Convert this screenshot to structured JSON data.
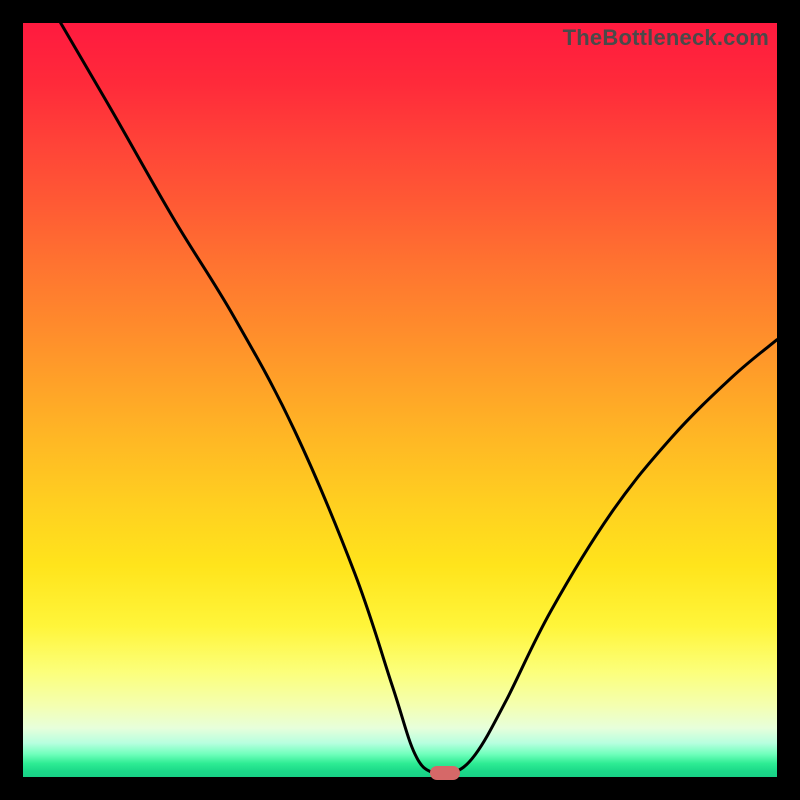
{
  "watermark": "TheBottleneck.com",
  "chart_data": {
    "type": "line",
    "title": "",
    "xlabel": "",
    "ylabel": "",
    "xlim": [
      0,
      100
    ],
    "ylim": [
      0,
      100
    ],
    "grid": false,
    "legend": false,
    "series": [
      {
        "name": "bottleneck-curve",
        "x": [
          5,
          12,
          20,
          28,
          36,
          44,
          49,
          52,
          54.5,
          57,
          60,
          64,
          70,
          78,
          86,
          94,
          100
        ],
        "y": [
          100,
          88,
          74,
          61,
          46,
          27,
          12,
          3,
          0.5,
          0.5,
          3,
          10,
          22,
          35,
          45,
          53,
          58
        ]
      }
    ],
    "marker": {
      "x": 56,
      "y": 0.5,
      "color": "#d66868"
    },
    "background_gradient": {
      "top": "#ff1a3f",
      "mid": "#ffd020",
      "bottom": "#18d086"
    }
  }
}
